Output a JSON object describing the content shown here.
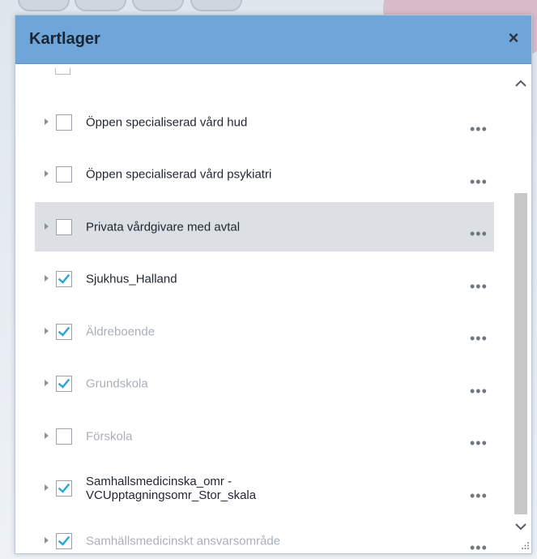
{
  "window": {
    "title": "Kartlager",
    "close_glyph": "×"
  },
  "layers": [
    {
      "label": "Öppen specialiserad vård hud",
      "checked": false,
      "dim": false,
      "hover": false
    },
    {
      "label": "Öppen specialiserad vård psykiatri",
      "checked": false,
      "dim": false,
      "hover": false
    },
    {
      "label": "Privata vårdgivare med avtal",
      "checked": false,
      "dim": false,
      "hover": true
    },
    {
      "label": "Sjukhus_Halland",
      "checked": true,
      "dim": false,
      "hover": false
    },
    {
      "label": "Äldreboende",
      "checked": true,
      "dim": true,
      "hover": false
    },
    {
      "label": "Grundskola",
      "checked": true,
      "dim": true,
      "hover": false
    },
    {
      "label": "Förskola",
      "checked": false,
      "dim": true,
      "hover": false
    },
    {
      "label": "Samhallsmedicinska_omr - VCUpptagningsomr_Stor_skala",
      "checked": true,
      "dim": false,
      "hover": false
    },
    {
      "label": "Samhällsmedicinskt ansvarsområde",
      "checked": true,
      "dim": true,
      "hover": false
    }
  ],
  "more_glyph": "•••",
  "icons": {
    "expander": "caret-right-icon",
    "check": "checkmark-icon",
    "more": "ellipsis-icon",
    "scroll_up": "chevron-up-icon",
    "scroll_down": "chevron-down-icon",
    "resize": "resize-grip-icon"
  },
  "colors": {
    "titlebar": "#6fa6da",
    "check": "#2aa6d6",
    "hover_row": "#dcdfe3",
    "dim_text": "#a8b0b8"
  }
}
